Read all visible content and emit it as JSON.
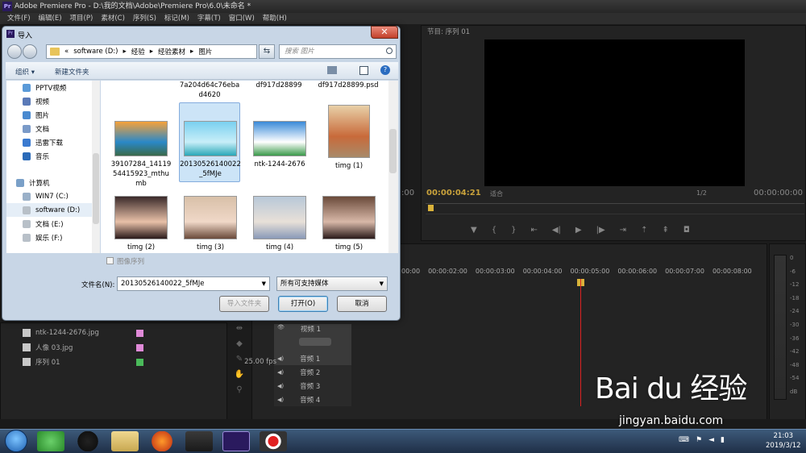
{
  "window": {
    "title": "Adobe Premiere Pro - D:\\我的文档\\Adobe\\Premiere Pro\\6.0\\未命名 *",
    "logo": "Pr"
  },
  "menu": [
    "文件(F)",
    "编辑(E)",
    "项目(P)",
    "素材(C)",
    "序列(S)",
    "标记(M)",
    "字幕(T)",
    "窗口(W)",
    "帮助(H)"
  ],
  "program": {
    "tab": "节目: 序列 01",
    "time_left": "00:00:04:21",
    "fit": "适合",
    "ratio": "1/2",
    "time_right": "00:00:00:00",
    "prev_time": ":00"
  },
  "timeline": {
    "ruler": [
      "00:00",
      "00:00:02:00",
      "00:00:03:00",
      "00:00:04:00",
      "00:00:05:00",
      "00:00:06:00",
      "00:00:07:00",
      "00:00:08:00"
    ],
    "tracks": [
      "视频 1",
      "音频 1",
      "音频 2",
      "音频 3",
      "音频 4"
    ]
  },
  "meter": {
    "scale": [
      "0",
      "-6",
      "-12",
      "-18",
      "-24",
      "-30",
      "-36",
      "-42",
      "-48",
      "-54",
      "dB"
    ]
  },
  "project": {
    "items": [
      {
        "name": "ntk-1244-2676.jpg",
        "fps": "",
        "color": "#e08ad8"
      },
      {
        "name": "人像 03.jpg",
        "fps": "",
        "color": "#e08ad8"
      },
      {
        "name": "序列 01",
        "fps": "25.00 fps",
        "color": "#4aba5a"
      }
    ]
  },
  "dialog": {
    "title": "导入",
    "address": [
      "«",
      "software (D:)",
      "▸",
      "经验",
      "▸",
      "经验素材",
      "▸",
      "图片"
    ],
    "search_placeholder": "搜索 图片",
    "toolbar": {
      "organize": "组织 ▾",
      "new_folder": "新建文件夹"
    },
    "nav": [
      {
        "label": "PPTV视频",
        "color": "#5a9ad8"
      },
      {
        "label": "视频",
        "color": "#5a7ab8"
      },
      {
        "label": "图片",
        "color": "#4a8ad0"
      },
      {
        "label": "文档",
        "color": "#7a9ac8"
      },
      {
        "label": "迅雷下载",
        "color": "#3a7ad0"
      },
      {
        "label": "音乐",
        "color": "#2a6ab8"
      },
      {
        "label": "计算机",
        "color": "#7aa0c8"
      },
      {
        "label": "WIN7 (C:)",
        "color": "#9ab0c8"
      },
      {
        "label": "software (D:)",
        "color": "#b8c0c8"
      },
      {
        "label": "文档 (E:)",
        "color": "#b8c0c8"
      },
      {
        "label": "娱乐 (F:)",
        "color": "#b8c0c8"
      }
    ],
    "files_top": [
      "7a204d64c76ebad4620",
      "df917d28899",
      "df917d28899.psd"
    ],
    "files": [
      {
        "name": "39107284_1411954415923_mthumb",
        "colors": [
          "#f6a23a",
          "#2a88c8",
          "#3a6a4a"
        ]
      },
      {
        "name": "20130526140022_5fMJe",
        "colors": [
          "#7ad0f0",
          "#c8eef8",
          "#2aa8b8"
        ]
      },
      {
        "name": "ntk-1244-2676",
        "colors": [
          "#3a8ad8",
          "#ffffff",
          "#3a9a4a"
        ]
      },
      {
        "name": "timg (1)",
        "colors": [
          "#e8d0a8",
          "#c86a3a",
          "#a88a6a"
        ]
      },
      {
        "name": "timg (2)",
        "colors": [
          "#3a2a2a",
          "#e8c0a8",
          "#2a1a1a"
        ]
      },
      {
        "name": "timg (3)",
        "colors": [
          "#d8c0a8",
          "#f0d8c8",
          "#6a4a3a"
        ]
      },
      {
        "name": "timg (4)",
        "colors": [
          "#b8c8d8",
          "#e8e0d8",
          "#8a9ab8"
        ]
      },
      {
        "name": "timg (5)",
        "colors": [
          "#6a4a3a",
          "#d8b8a8",
          "#2a1a1a"
        ]
      }
    ],
    "image_sequence": "图像序列",
    "filename_label": "文件名(N):",
    "filename_value": "20130526140022_5fMJe",
    "filetype": "所有可支持媒体",
    "buttons": {
      "import_folder": "导入文件夹",
      "open": "打开(O)",
      "cancel": "取消"
    }
  },
  "tray": {
    "time": "21:03",
    "date": "2019/3/12"
  },
  "watermark": {
    "main": "Bai du 经验",
    "sub": "jingyan.baidu.com"
  }
}
